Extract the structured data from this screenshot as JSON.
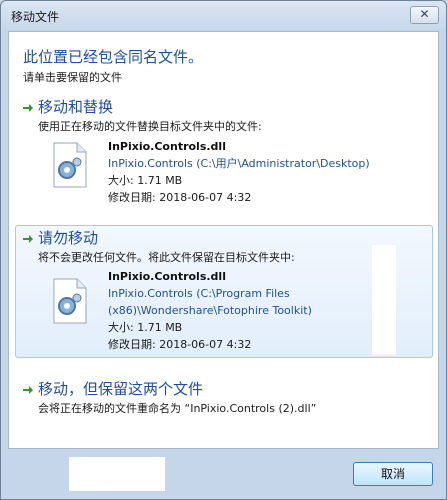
{
  "window": {
    "title": "移动文件",
    "close_glyph": "✕"
  },
  "dialog": {
    "heading": "此位置已经包含同名文件。",
    "subheading": "请单击要保留的文件"
  },
  "options": [
    {
      "title": "移动和替换",
      "description": "使用正在移动的文件替换目标文件夹中的文件:",
      "file": {
        "name": "InPixio.Controls.dll",
        "path_lines": [
          "InPixio.Controls (C:\\用户\\Administrator\\Desktop)"
        ],
        "size": "大小: 1.71 MB",
        "modified": "修改日期: 2018-06-07 4:32"
      }
    },
    {
      "title": "请勿移动",
      "description": "将不会更改任何文件。将此文件保留在目标文件夹中:",
      "file": {
        "name": "InPixio.Controls.dll",
        "path_lines": [
          "InPixio.Controls (C:\\Program Files",
          "(x86)\\Wondershare\\Fotophire Toolkit)"
        ],
        "size": "大小: 1.71 MB",
        "modified": "修改日期: 2018-06-07 4:32"
      }
    },
    {
      "title": "移动，但保留这两个文件",
      "description": "会将正在移动的文件重命名为 “InPixio.Controls (2).dll”"
    }
  ],
  "buttons": {
    "cancel": "取消"
  },
  "colors": {
    "link_blue": "#1f4f9c",
    "arrow_green": "#2f9a2a",
    "selected_border": "#a9c8ea"
  }
}
